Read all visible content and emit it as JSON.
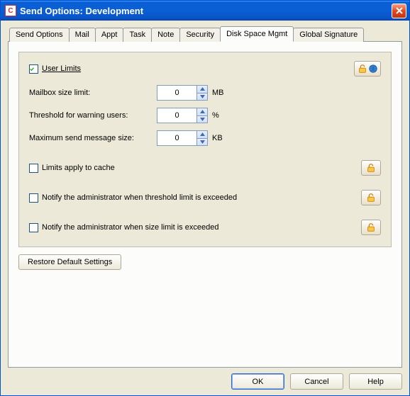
{
  "window": {
    "title": "Send Options:  Development"
  },
  "tabs": [
    {
      "label": "Send Options"
    },
    {
      "label": "Mail"
    },
    {
      "label": "Appt"
    },
    {
      "label": "Task"
    },
    {
      "label": "Note"
    },
    {
      "label": "Security"
    },
    {
      "label": "Disk Space Mgmt",
      "active": true
    },
    {
      "label": "Global Signature"
    }
  ],
  "group": {
    "user_limits": {
      "label": "User Limits",
      "checked": true
    },
    "mailbox": {
      "label": "Mailbox size limit:",
      "value": "0",
      "unit": "MB"
    },
    "threshold": {
      "label": "Threshold for warning users:",
      "value": "0",
      "unit": "%"
    },
    "maxsend": {
      "label": "Maximum send message size:",
      "value": "0",
      "unit": "KB"
    },
    "limits_cache": {
      "label": "Limits apply to cache",
      "checked": false
    },
    "notify_threshold": {
      "label": "Notify the administrator when threshold limit is exceeded",
      "checked": false
    },
    "notify_size": {
      "label": "Notify the administrator when size limit is exceeded",
      "checked": false
    }
  },
  "buttons": {
    "restore": "Restore Default Settings",
    "ok": "OK",
    "cancel": "Cancel",
    "help": "Help"
  }
}
